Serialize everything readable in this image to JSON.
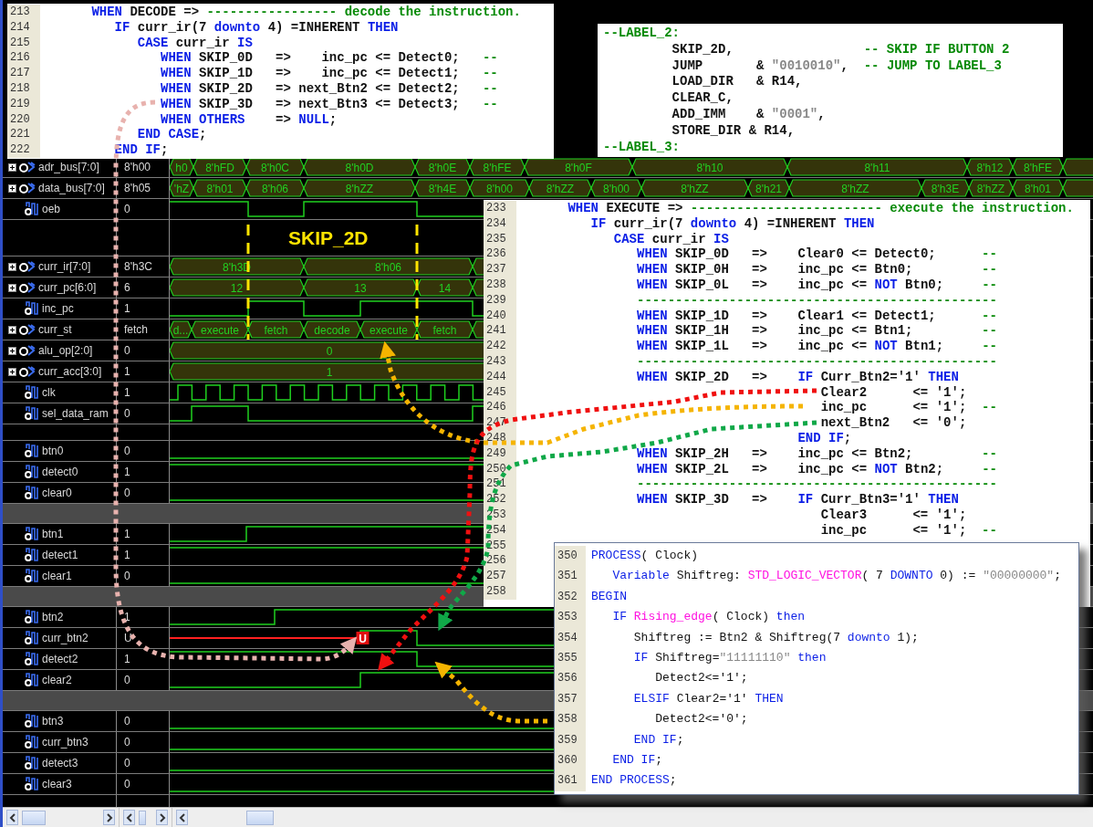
{
  "rows": [
    {
      "kind": "bus",
      "name": "adr_bus[7:0]",
      "value": "8'h00",
      "segments": [
        "h0",
        "8'hFD",
        "8'h0C",
        "8'h0D",
        "8'h0E",
        "8'hFE",
        "8'h0F",
        "8'h10",
        "8'h11",
        "8'h12",
        "8'hFE"
      ]
    },
    {
      "kind": "bus",
      "name": "data_bus[7:0]",
      "value": "8'h05",
      "segments": [
        "'hZ",
        "8'h01",
        "8'h06",
        "8'hZZ",
        "8'h4E",
        "8'h00",
        "8'hZZ",
        "8'h00",
        "8'hZZ",
        "8'h21",
        "8'hZZ",
        "8'h3E",
        "8'hZZ",
        "8'h01"
      ]
    },
    {
      "kind": "bit",
      "name": "oeb",
      "value": "0"
    },
    {
      "kind": "spacer",
      "label": "SKIP_2D"
    },
    {
      "kind": "bus",
      "name": "curr_ir[7:0]",
      "value": "8'h3C",
      "segments": [
        "8'h3D",
        "8'h06"
      ]
    },
    {
      "kind": "bus",
      "name": "curr_pc[6:0]",
      "value": "6",
      "segments": [
        "12",
        "13",
        "14"
      ]
    },
    {
      "kind": "bit",
      "name": "inc_pc",
      "value": "1"
    },
    {
      "kind": "state",
      "name": "curr_st",
      "value": "fetch",
      "segments": [
        "d...",
        "execute",
        "fetch",
        "decode",
        "execute",
        "fetch"
      ]
    },
    {
      "kind": "bus",
      "name": "alu_op[2:0]",
      "value": "0",
      "segments": [
        "0"
      ]
    },
    {
      "kind": "bus",
      "name": "curr_acc[3:0]",
      "value": "1",
      "segments": [
        "1"
      ]
    },
    {
      "kind": "bit",
      "name": "clk",
      "value": "1"
    },
    {
      "kind": "bit",
      "name": "sel_data_ram",
      "value": "0"
    },
    {
      "kind": "spacer"
    },
    {
      "kind": "bit",
      "name": "btn0",
      "value": "0"
    },
    {
      "kind": "bit",
      "name": "detect0",
      "value": "1"
    },
    {
      "kind": "bit",
      "name": "clear0",
      "value": "0"
    },
    {
      "kind": "gap"
    },
    {
      "kind": "bit",
      "name": "btn1",
      "value": "1"
    },
    {
      "kind": "bit",
      "name": "detect1",
      "value": "1"
    },
    {
      "kind": "bit",
      "name": "clear1",
      "value": "0"
    },
    {
      "kind": "gap"
    },
    {
      "kind": "bit",
      "name": "btn2",
      "value": "1"
    },
    {
      "kind": "bit",
      "name": "curr_btn2",
      "value": "U",
      "marker": "U"
    },
    {
      "kind": "bit",
      "name": "detect2",
      "value": "1"
    },
    {
      "kind": "bit",
      "name": "clear2",
      "value": "0"
    },
    {
      "kind": "gap"
    },
    {
      "kind": "bit",
      "name": "btn3",
      "value": "0"
    },
    {
      "kind": "bit",
      "name": "curr_btn3",
      "value": "0"
    },
    {
      "kind": "bit",
      "name": "detect3",
      "value": "0"
    },
    {
      "kind": "bit",
      "name": "clear3",
      "value": "0"
    }
  ],
  "code_windows": [
    {
      "lines": [
        {
          "number": "213",
          "tokens": [
            {
              "kind": "keyword",
              "text": "      WHEN"
            },
            {
              "kind": "plain",
              "text": " DECODE => "
            },
            {
              "kind": "comment",
              "text": "----------------- decode the instruction."
            }
          ]
        },
        {
          "number": "214",
          "tokens": [
            {
              "kind": "keyword",
              "text": "         IF"
            },
            {
              "kind": "plain",
              "text": " curr_ir(7 "
            },
            {
              "kind": "keyword",
              "text": "downto"
            },
            {
              "kind": "plain",
              "text": " 4) =INHERENT "
            },
            {
              "kind": "keyword",
              "text": "THEN"
            }
          ]
        },
        {
          "number": "215",
          "tokens": [
            {
              "kind": "keyword",
              "text": "            CASE"
            },
            {
              "kind": "plain",
              "text": " curr_ir "
            },
            {
              "kind": "keyword",
              "text": "IS"
            }
          ]
        },
        {
          "number": "216",
          "tokens": [
            {
              "kind": "keyword",
              "text": "               WHEN"
            },
            {
              "kind": "plain",
              "text": " SKIP_0D   =>    inc_pc <= Detect0;   "
            },
            {
              "kind": "comment",
              "text": "--"
            }
          ]
        },
        {
          "number": "217",
          "tokens": [
            {
              "kind": "keyword",
              "text": "               WHEN"
            },
            {
              "kind": "plain",
              "text": " SKIP_1D   =>    inc_pc <= Detect1;   "
            },
            {
              "kind": "comment",
              "text": "--"
            }
          ]
        },
        {
          "number": "218",
          "tokens": [
            {
              "kind": "keyword",
              "text": "               WHEN"
            },
            {
              "kind": "plain",
              "text": " SKIP_2D   => next_Btn2 <= Detect2;   "
            },
            {
              "kind": "comment",
              "text": "--"
            }
          ]
        },
        {
          "number": "219",
          "tokens": [
            {
              "kind": "keyword",
              "text": "               WHEN"
            },
            {
              "kind": "plain",
              "text": " SKIP_3D   => next_Btn3 <= Detect3;   "
            },
            {
              "kind": "comment",
              "text": "--"
            }
          ]
        },
        {
          "number": "220",
          "tokens": [
            {
              "kind": "keyword",
              "text": "               WHEN OTHERS"
            },
            {
              "kind": "plain",
              "text": "    => "
            },
            {
              "kind": "keyword",
              "text": "NULL"
            },
            {
              "kind": "plain",
              "text": ";"
            }
          ]
        },
        {
          "number": "221",
          "tokens": [
            {
              "kind": "keyword",
              "text": "            END CASE"
            },
            {
              "kind": "plain",
              "text": ";"
            }
          ]
        },
        {
          "number": "222",
          "tokens": [
            {
              "kind": "keyword",
              "text": "         END IF"
            },
            {
              "kind": "plain",
              "text": ";"
            }
          ]
        }
      ]
    },
    {
      "lines": [
        {
          "tokens": [
            {
              "kind": "comment",
              "text": "--LABEL_2:"
            }
          ]
        },
        {
          "tokens": [
            {
              "kind": "plain",
              "text": "         SKIP_2D,                 "
            },
            {
              "kind": "comment",
              "text": "-- SKIP IF BUTTON 2"
            }
          ]
        },
        {
          "tokens": [
            {
              "kind": "plain",
              "text": "         JUMP       & "
            },
            {
              "kind": "string",
              "text": "\"0010010\""
            },
            {
              "kind": "plain",
              "text": ",  "
            },
            {
              "kind": "comment",
              "text": "-- JUMP TO LABEL_3"
            }
          ]
        },
        {
          "tokens": [
            {
              "kind": "plain",
              "text": "         LOAD_DIR   & R14,"
            }
          ]
        },
        {
          "tokens": [
            {
              "kind": "plain",
              "text": "         CLEAR_C,"
            }
          ]
        },
        {
          "tokens": [
            {
              "kind": "plain",
              "text": "         ADD_IMM    & "
            },
            {
              "kind": "string",
              "text": "\"0001\""
            },
            {
              "kind": "plain",
              "text": ","
            }
          ]
        },
        {
          "tokens": [
            {
              "kind": "plain",
              "text": "         STORE_DIR & R14,"
            }
          ]
        },
        {
          "tokens": [
            {
              "kind": "comment",
              "text": "--LABEL_3:"
            }
          ]
        }
      ]
    },
    {
      "lines": [
        {
          "number": "233",
          "tokens": [
            {
              "kind": "keyword",
              "text": "      WHEN"
            },
            {
              "kind": "plain",
              "text": " EXECUTE => "
            },
            {
              "kind": "comment",
              "text": "------------------------- execute the instruction."
            }
          ]
        },
        {
          "number": "234",
          "tokens": [
            {
              "kind": "keyword",
              "text": "         IF"
            },
            {
              "kind": "plain",
              "text": " curr_ir(7 "
            },
            {
              "kind": "keyword",
              "text": "downto"
            },
            {
              "kind": "plain",
              "text": " 4) =INHERENT "
            },
            {
              "kind": "keyword",
              "text": "THEN"
            }
          ]
        },
        {
          "number": "235",
          "tokens": [
            {
              "kind": "keyword",
              "text": "            CASE"
            },
            {
              "kind": "plain",
              "text": " curr_ir "
            },
            {
              "kind": "keyword",
              "text": "IS"
            }
          ]
        },
        {
          "number": "236",
          "tokens": [
            {
              "kind": "keyword",
              "text": "               WHEN"
            },
            {
              "kind": "plain",
              "text": " SKIP_0D   =>    Clear0 <= Detect0;      "
            },
            {
              "kind": "comment",
              "text": "--"
            }
          ]
        },
        {
          "number": "237",
          "tokens": [
            {
              "kind": "keyword",
              "text": "               WHEN"
            },
            {
              "kind": "plain",
              "text": " SKIP_0H   =>    inc_pc <= Btn0;         "
            },
            {
              "kind": "comment",
              "text": "--"
            }
          ]
        },
        {
          "number": "238",
          "tokens": [
            {
              "kind": "keyword",
              "text": "               WHEN"
            },
            {
              "kind": "plain",
              "text": " SKIP_0L   =>    inc_pc <= "
            },
            {
              "kind": "keyword",
              "text": "NOT"
            },
            {
              "kind": "plain",
              "text": " Btn0;     "
            },
            {
              "kind": "comment",
              "text": "--"
            }
          ]
        },
        {
          "number": "239",
          "tokens": [
            {
              "kind": "comment",
              "text": "               -----------------------------------------------"
            }
          ]
        },
        {
          "number": "240",
          "tokens": [
            {
              "kind": "keyword",
              "text": "               WHEN"
            },
            {
              "kind": "plain",
              "text": " SKIP_1D   =>    Clear1 <= Detect1;      "
            },
            {
              "kind": "comment",
              "text": "--"
            }
          ]
        },
        {
          "number": "241",
          "tokens": [
            {
              "kind": "keyword",
              "text": "               WHEN"
            },
            {
              "kind": "plain",
              "text": " SKIP_1H   =>    inc_pc <= Btn1;         "
            },
            {
              "kind": "comment",
              "text": "--"
            }
          ]
        },
        {
          "number": "242",
          "tokens": [
            {
              "kind": "keyword",
              "text": "               WHEN"
            },
            {
              "kind": "plain",
              "text": " SKIP_1L   =>    inc_pc <= "
            },
            {
              "kind": "keyword",
              "text": "NOT"
            },
            {
              "kind": "plain",
              "text": " Btn1;     "
            },
            {
              "kind": "comment",
              "text": "--"
            }
          ]
        },
        {
          "number": "243",
          "tokens": [
            {
              "kind": "comment",
              "text": "               -----------------------------------------------"
            }
          ]
        },
        {
          "number": "244",
          "tokens": [
            {
              "kind": "keyword",
              "text": "               WHEN"
            },
            {
              "kind": "plain",
              "text": " SKIP_2D   =>    "
            },
            {
              "kind": "keyword",
              "text": "IF"
            },
            {
              "kind": "plain",
              "text": " Curr_Btn2='1' "
            },
            {
              "kind": "keyword",
              "text": "THEN"
            }
          ]
        },
        {
          "number": "245",
          "tokens": [
            {
              "kind": "plain",
              "text": "                                       Clear2      <= '1';"
            }
          ]
        },
        {
          "number": "246",
          "tokens": [
            {
              "kind": "plain",
              "text": "                                       inc_pc      <= '1';  "
            },
            {
              "kind": "comment",
              "text": "--"
            }
          ]
        },
        {
          "number": "247",
          "tokens": [
            {
              "kind": "plain",
              "text": "                                       next_Btn2   <= '0';"
            }
          ]
        },
        {
          "number": "248",
          "tokens": [
            {
              "kind": "keyword",
              "text": "                                    END IF"
            },
            {
              "kind": "plain",
              "text": ";"
            }
          ]
        },
        {
          "number": "249",
          "tokens": [
            {
              "kind": "keyword",
              "text": "               WHEN"
            },
            {
              "kind": "plain",
              "text": " SKIP_2H   =>    inc_pc <= Btn2;         "
            },
            {
              "kind": "comment",
              "text": "--"
            }
          ]
        },
        {
          "number": "250",
          "tokens": [
            {
              "kind": "keyword",
              "text": "               WHEN"
            },
            {
              "kind": "plain",
              "text": " SKIP_2L   =>    inc_pc <= "
            },
            {
              "kind": "keyword",
              "text": "NOT"
            },
            {
              "kind": "plain",
              "text": " Btn2;     "
            },
            {
              "kind": "comment",
              "text": "--"
            }
          ]
        },
        {
          "number": "251",
          "tokens": [
            {
              "kind": "comment",
              "text": "               -----------------------------------------------"
            }
          ]
        },
        {
          "number": "252",
          "tokens": [
            {
              "kind": "keyword",
              "text": "               WHEN"
            },
            {
              "kind": "plain",
              "text": " SKIP_3D   =>    "
            },
            {
              "kind": "keyword",
              "text": "IF"
            },
            {
              "kind": "plain",
              "text": " Curr_Btn3='1' "
            },
            {
              "kind": "keyword",
              "text": "THEN"
            }
          ]
        },
        {
          "number": "253",
          "tokens": [
            {
              "kind": "plain",
              "text": "                                       Clear3      <= '1';"
            }
          ]
        },
        {
          "number": "254",
          "tokens": [
            {
              "kind": "plain",
              "text": "                                       inc_pc      <= '1';  "
            },
            {
              "kind": "comment",
              "text": "--"
            }
          ]
        },
        {
          "number": "255"
        },
        {
          "number": "256"
        },
        {
          "number": "257"
        },
        {
          "number": "258"
        }
      ]
    },
    {
      "lines": [
        {
          "number": "350",
          "tokens": [
            {
              "kind": "keyword",
              "text": "PROCESS"
            },
            {
              "kind": "plain",
              "text": "( Clock)"
            }
          ]
        },
        {
          "number": "351",
          "tokens": [
            {
              "kind": "keyword",
              "text": "   Variable"
            },
            {
              "kind": "plain",
              "text": " Shiftreg: "
            },
            {
              "kind": "function",
              "text": "STD_LOGIC_VECTOR"
            },
            {
              "kind": "plain",
              "text": "( 7 "
            },
            {
              "kind": "keyword",
              "text": "DOWNTO"
            },
            {
              "kind": "plain",
              "text": " 0) := "
            },
            {
              "kind": "string",
              "text": "\"00000000\""
            },
            {
              "kind": "plain",
              "text": ";"
            }
          ]
        },
        {
          "number": "352",
          "tokens": [
            {
              "kind": "keyword",
              "text": "BEGIN"
            }
          ]
        },
        {
          "number": "353",
          "tokens": [
            {
              "kind": "keyword",
              "text": "   IF "
            },
            {
              "kind": "function",
              "text": "Rising_edge"
            },
            {
              "kind": "plain",
              "text": "( Clock) "
            },
            {
              "kind": "keyword",
              "text": "then"
            }
          ]
        },
        {
          "number": "354",
          "tokens": [
            {
              "kind": "plain",
              "text": "      Shiftreg := Btn2 & Shiftreg(7 "
            },
            {
              "kind": "keyword",
              "text": "downto"
            },
            {
              "kind": "plain",
              "text": " 1);"
            }
          ]
        },
        {
          "number": "355",
          "tokens": [
            {
              "kind": "keyword",
              "text": "      IF"
            },
            {
              "kind": "plain",
              "text": " Shiftreg="
            },
            {
              "kind": "string",
              "text": "\"11111110\""
            },
            {
              "kind": "keyword",
              "text": " then"
            }
          ]
        },
        {
          "number": "356",
          "tokens": [
            {
              "kind": "plain",
              "text": "         Detect2<='1';"
            }
          ]
        },
        {
          "number": "357",
          "tokens": [
            {
              "kind": "keyword",
              "text": "      ELSIF"
            },
            {
              "kind": "plain",
              "text": " Clear2='1' "
            },
            {
              "kind": "keyword",
              "text": "THEN"
            }
          ]
        },
        {
          "number": "358",
          "tokens": [
            {
              "kind": "plain",
              "text": "         Detect2<='0';"
            }
          ]
        },
        {
          "number": "359",
          "tokens": [
            {
              "kind": "keyword",
              "text": "      END IF"
            },
            {
              "kind": "plain",
              "text": ";"
            }
          ]
        },
        {
          "number": "360",
          "tokens": [
            {
              "kind": "keyword",
              "text": "   END IF"
            },
            {
              "kind": "plain",
              "text": ";"
            }
          ]
        },
        {
          "number": "361",
          "tokens": [
            {
              "kind": "keyword",
              "text": "END PROCESS"
            },
            {
              "kind": "plain",
              "text": ";"
            }
          ]
        }
      ]
    }
  ],
  "arrows": [
    {
      "color": "#e8b2ae"
    },
    {
      "color": "#f5b400"
    },
    {
      "color": "#f5b400"
    },
    {
      "color": "#f01010"
    },
    {
      "color": "#10a848"
    }
  ]
}
